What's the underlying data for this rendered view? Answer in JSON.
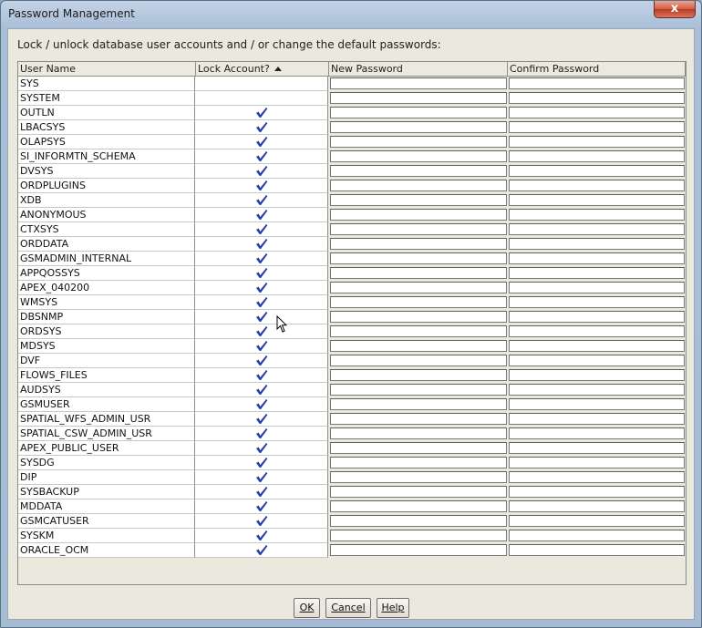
{
  "window": {
    "title": "Password Management",
    "close_label": "x"
  },
  "instructions": "Lock / unlock database user accounts and / or change the default passwords:",
  "columns": {
    "user_name": "User Name",
    "lock_account": "Lock Account?",
    "new_password": "New Password",
    "confirm_password": "Confirm Password"
  },
  "users": [
    {
      "name": "SYS",
      "locked": false
    },
    {
      "name": "SYSTEM",
      "locked": false
    },
    {
      "name": "OUTLN",
      "locked": true
    },
    {
      "name": "LBACSYS",
      "locked": true
    },
    {
      "name": "OLAPSYS",
      "locked": true
    },
    {
      "name": "SI_INFORMTN_SCHEMA",
      "locked": true
    },
    {
      "name": "DVSYS",
      "locked": true
    },
    {
      "name": "ORDPLUGINS",
      "locked": true
    },
    {
      "name": "XDB",
      "locked": true
    },
    {
      "name": "ANONYMOUS",
      "locked": true
    },
    {
      "name": "CTXSYS",
      "locked": true
    },
    {
      "name": "ORDDATA",
      "locked": true
    },
    {
      "name": "GSMADMIN_INTERNAL",
      "locked": true
    },
    {
      "name": "APPQOSSYS",
      "locked": true
    },
    {
      "name": "APEX_040200",
      "locked": true
    },
    {
      "name": "WMSYS",
      "locked": true
    },
    {
      "name": "DBSNMP",
      "locked": true
    },
    {
      "name": "ORDSYS",
      "locked": true
    },
    {
      "name": "MDSYS",
      "locked": true
    },
    {
      "name": "DVF",
      "locked": true
    },
    {
      "name": "FLOWS_FILES",
      "locked": true
    },
    {
      "name": "AUDSYS",
      "locked": true
    },
    {
      "name": "GSMUSER",
      "locked": true
    },
    {
      "name": "SPATIAL_WFS_ADMIN_USR",
      "locked": true
    },
    {
      "name": "SPATIAL_CSW_ADMIN_USR",
      "locked": true
    },
    {
      "name": "APEX_PUBLIC_USER",
      "locked": true
    },
    {
      "name": "SYSDG",
      "locked": true
    },
    {
      "name": "DIP",
      "locked": true
    },
    {
      "name": "SYSBACKUP",
      "locked": true
    },
    {
      "name": "MDDATA",
      "locked": true
    },
    {
      "name": "GSMCATUSER",
      "locked": true
    },
    {
      "name": "SYSKM",
      "locked": true
    },
    {
      "name": "ORACLE_OCM",
      "locked": true
    }
  ],
  "buttons": {
    "ok": "OK",
    "cancel": "Cancel",
    "help": "Help"
  },
  "colors": {
    "checkmark": "#1f3fa8"
  }
}
